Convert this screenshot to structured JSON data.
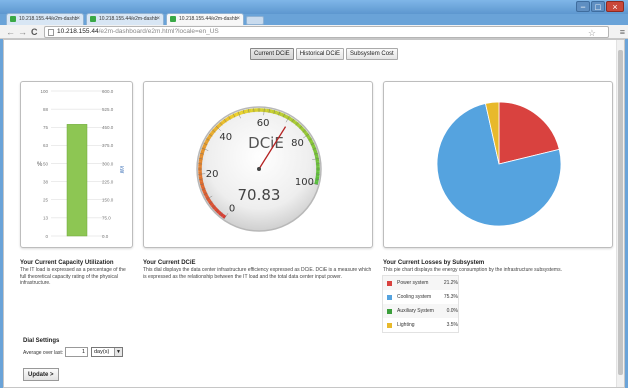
{
  "browser": {
    "tabs": [
      {
        "title": "10.218.155.44/e2m-dashb"
      },
      {
        "title": "10.218.155.44/e2m-dashb"
      },
      {
        "title": "10.218.155.44/e2m-dashb"
      }
    ],
    "url_host": "10.218.155.44",
    "url_path": "/e2m-dashboard/e2m.html?locale=en_US",
    "window_buttons": {
      "min": "−",
      "max": "□",
      "close": "×"
    }
  },
  "view_buttons": [
    {
      "label": "Current DCiE"
    },
    {
      "label": "Historical DCiE"
    },
    {
      "label": "Subsystem Cost"
    }
  ],
  "capacity": {
    "left_ticks": [
      "100",
      "88",
      "75",
      "63",
      "50",
      "38",
      "25",
      "13",
      "0"
    ],
    "right_ticks": [
      "600.0",
      "525.0",
      "450.0",
      "375.0",
      "300.0",
      "225.0",
      "150.0",
      "75.0",
      "0.0"
    ],
    "left_unit": "%",
    "right_unit": "kW",
    "fill_percent": 77,
    "title": "Your Current Capacity Utilization",
    "description": "The IT load is expressed as a percentage of the full theoretical capacity rating of the physical infrastructure."
  },
  "dcie": {
    "gauge_label": "DCiE",
    "scale": [
      "0",
      "20",
      "40",
      "60",
      "80",
      "100"
    ],
    "value": "70.83",
    "title": "Your Current DCiE",
    "description": "This dial displays the data center infrastructure efficiency expressed as DCiE. DCiE is a measure which is expressed as the relationship between the IT load and the total data center input power."
  },
  "losses": {
    "title": "Your Current Losses by Subsystem",
    "description": "This pie chart displays the energy consumption by the infrastructure subsystems."
  },
  "chart_data": {
    "type": "pie",
    "labels": [
      "Power system",
      "Cooling system",
      "Auxiliary System",
      "Lighting"
    ],
    "values": [
      21.2,
      75.3,
      0.0,
      3.5
    ],
    "display_values": [
      "21.2%",
      "75.3%",
      "0.0%",
      "3.5%"
    ],
    "colors": [
      "#d9423f",
      "#55a3df",
      "#3b9e3b",
      "#e8b92b"
    ]
  },
  "dial_settings": {
    "title": "Dial Settings",
    "average_label": "Average over last:",
    "average_value": "1",
    "unit": "day(s)",
    "update_label": "Update >"
  }
}
